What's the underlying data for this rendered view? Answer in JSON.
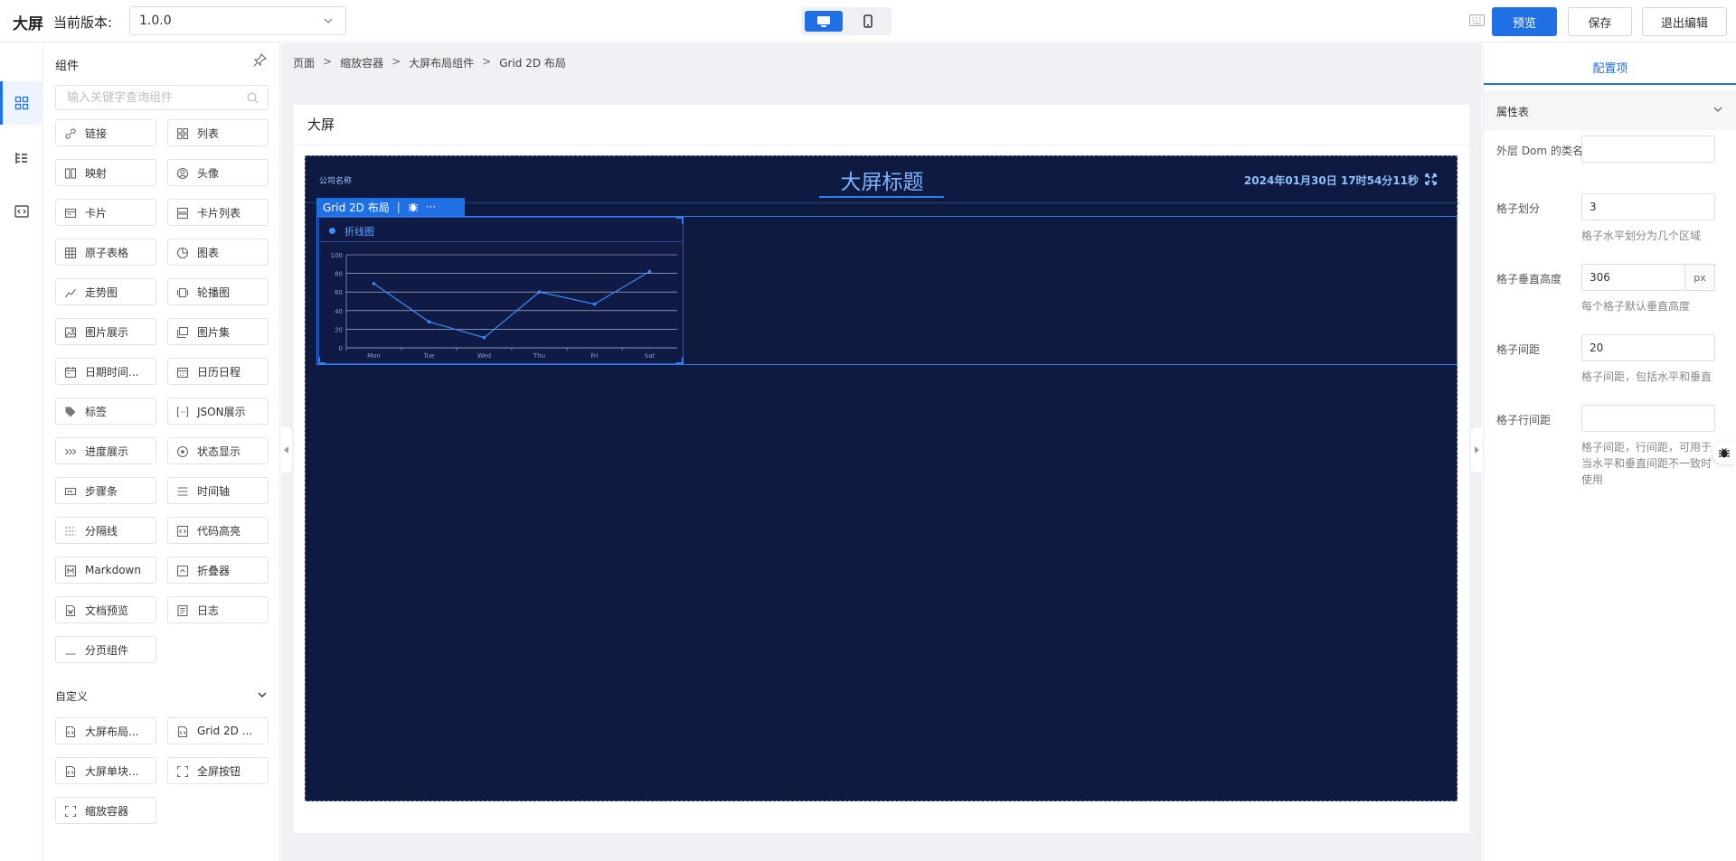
{
  "topbar": {
    "app_title": "大屏",
    "version_label": "当前版本:",
    "version_value": "1.0.0",
    "preview_label": "预览",
    "save_label": "保存",
    "exit_label": "退出编辑"
  },
  "panel": {
    "title": "组件",
    "search_placeholder": "输入关键字查询组件",
    "components": [
      {
        "label": "链接",
        "icon": "link-icon"
      },
      {
        "label": "列表",
        "icon": "list-grid-icon"
      },
      {
        "label": "映射",
        "icon": "mapping-icon"
      },
      {
        "label": "头像",
        "icon": "avatar-icon"
      },
      {
        "label": "卡片",
        "icon": "card-icon"
      },
      {
        "label": "卡片列表",
        "icon": "card-list-icon"
      },
      {
        "label": "原子表格",
        "icon": "table-icon"
      },
      {
        "label": "图表",
        "icon": "pie-chart-icon"
      },
      {
        "label": "走势图",
        "icon": "trend-icon"
      },
      {
        "label": "轮播图",
        "icon": "carousel-icon"
      },
      {
        "label": "图片展示",
        "icon": "image-icon"
      },
      {
        "label": "图片集",
        "icon": "image-set-icon"
      },
      {
        "label": "日期时间...",
        "icon": "datetime-icon"
      },
      {
        "label": "日历日程",
        "icon": "calendar-icon"
      },
      {
        "label": "标签",
        "icon": "tag-icon"
      },
      {
        "label": "JSON展示",
        "icon": "json-icon"
      },
      {
        "label": "进度展示",
        "icon": "progress-icon"
      },
      {
        "label": "状态显示",
        "icon": "status-icon"
      },
      {
        "label": "步骤条",
        "icon": "steps-icon"
      },
      {
        "label": "时间轴",
        "icon": "timeline-icon"
      },
      {
        "label": "分隔线",
        "icon": "divider-icon"
      },
      {
        "label": "代码高亮",
        "icon": "code-icon"
      },
      {
        "label": "Markdown",
        "icon": "markdown-icon"
      },
      {
        "label": "折叠器",
        "icon": "collapse-icon"
      },
      {
        "label": "文档预览",
        "icon": "doc-icon"
      },
      {
        "label": "日志",
        "icon": "log-icon"
      },
      {
        "label": "分页组件",
        "icon": "pagination-icon"
      }
    ],
    "custom_section": "自定义",
    "custom_components": [
      {
        "label": "大屏布局...",
        "icon": "code-file-icon"
      },
      {
        "label": "Grid 2D ...",
        "icon": "code-file-icon"
      },
      {
        "label": "大屏单块...",
        "icon": "code-file-icon"
      },
      {
        "label": "全屏按钮",
        "icon": "fullscreen-icon"
      },
      {
        "label": "缩放容器",
        "icon": "fullscreen-icon"
      }
    ]
  },
  "breadcrumb": [
    "页面",
    "缩放容器",
    "大屏布局组件",
    "Grid 2D 布局"
  ],
  "breadcrumb_sep": ">",
  "page": {
    "name": "大屏",
    "company": "公司名称",
    "screen_title": "大屏标题",
    "datetime": "2024年01月30日 17时54分11秒",
    "grid_toolbar_label": "Grid 2D 布局",
    "toolbar_divider": "|",
    "toolbar_more": "···",
    "chart_title": "折线图"
  },
  "chart_data": {
    "type": "line",
    "categories": [
      "Mon",
      "Tue",
      "Wed",
      "Thu",
      "Fri",
      "Sat"
    ],
    "values": [
      69,
      28,
      11,
      60,
      47,
      82
    ],
    "ylim": [
      0,
      100
    ],
    "yticks": [
      0,
      20,
      40,
      60,
      80,
      100
    ],
    "grid": true,
    "line_color": "#3b8cff"
  },
  "config": {
    "tab": "配置项",
    "section": "属性表",
    "rows": [
      {
        "label": "外层 Dom 的类名",
        "value": "",
        "hint": ""
      },
      {
        "label": "格子划分",
        "value": "3",
        "hint": "格子水平划分为几个区域"
      },
      {
        "label": "格子垂直高度",
        "value": "306",
        "unit": "px",
        "hint": "每个格子默认垂直高度"
      },
      {
        "label": "格子间距",
        "value": "20",
        "hint": "格子间距，包括水平和垂直"
      },
      {
        "label": "格子行间距",
        "value": "",
        "hint": "格子间距，行间距，可用于当水平和垂直间距不一致时使用"
      }
    ]
  },
  "colors": {
    "accent": "#1f6fe5",
    "screen_bg": "#0e1a40"
  }
}
